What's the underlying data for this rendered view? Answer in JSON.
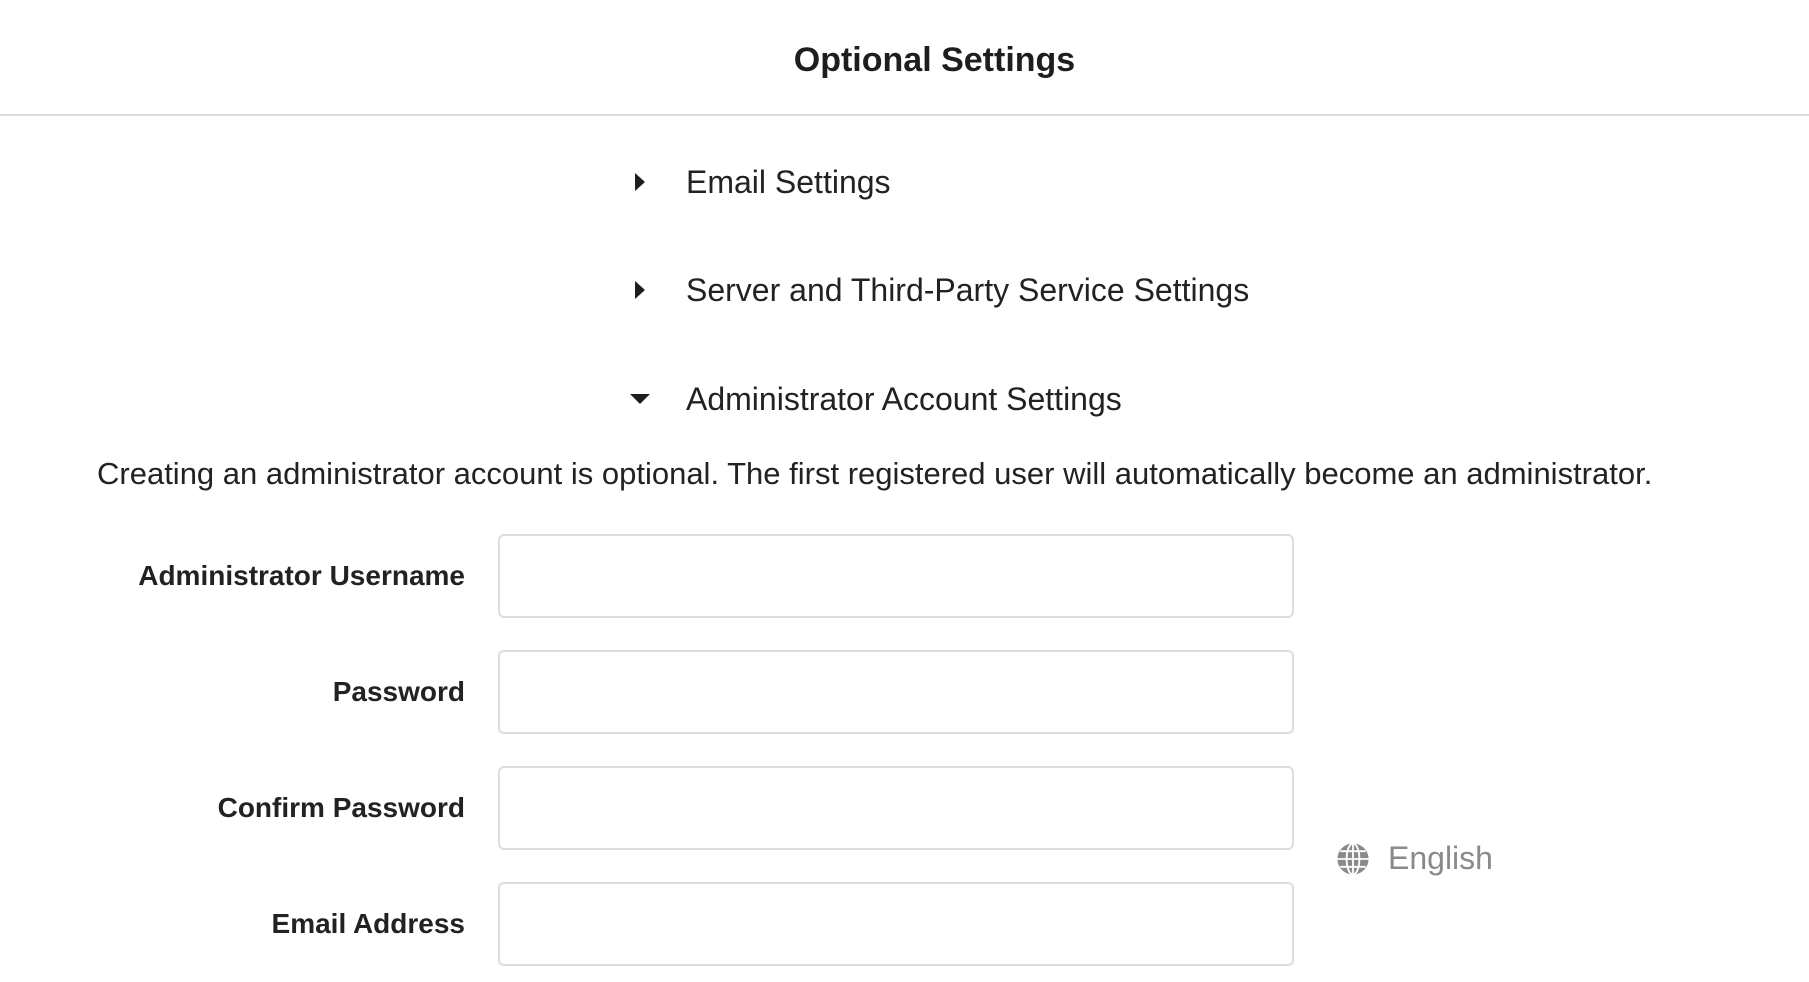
{
  "header": {
    "title": "Optional Settings"
  },
  "sections": [
    {
      "label": "Email Settings",
      "expanded": false
    },
    {
      "label": "Server and Third-Party Service Settings",
      "expanded": false
    },
    {
      "label": "Administrator Account Settings",
      "expanded": true
    }
  ],
  "admin": {
    "description": "Creating an administrator account is optional. The first registered user will automatically become an administrator.",
    "fields": [
      {
        "label": "Administrator Username",
        "value": ""
      },
      {
        "label": "Password",
        "value": ""
      },
      {
        "label": "Confirm Password",
        "value": ""
      },
      {
        "label": "Email Address",
        "value": ""
      }
    ]
  },
  "language": {
    "label": "English",
    "icon": "globe-icon"
  },
  "colors": {
    "muted": "#8a8a8a",
    "border": "#dedede",
    "text": "#222222"
  }
}
